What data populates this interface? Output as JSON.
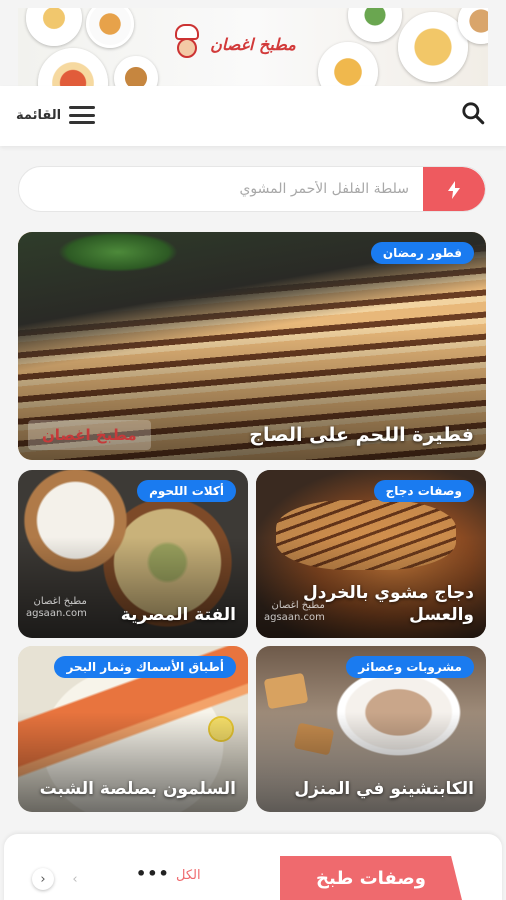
{
  "banner": {
    "logo_text": "مطبخ اغصان"
  },
  "header": {
    "menu_label": "القائمة"
  },
  "search": {
    "placeholder": "سلطة الفلفل الأحمر المشوي"
  },
  "featured": {
    "tag": "فطور رمضان",
    "title": "فطيرة اللحم على الصاج",
    "watermark": "مطبخ اغصان"
  },
  "cards": [
    {
      "tag": "وصفات دجاج",
      "title": "دجاج مشوي بالخردل والعسل",
      "watermark": "مطبخ اغصان\nagsaan.com"
    },
    {
      "tag": "أكلات اللحوم",
      "title": "الفتة المصرية",
      "watermark": "مطبخ اغصان\nagsaan.com"
    },
    {
      "tag": "مشروبات وعصائر",
      "title": "الكابتشينو في المنزل"
    },
    {
      "tag": "أطباق الأسماك وثمار البحر",
      "title": "السلمون بصلصة الشبت"
    }
  ],
  "section": {
    "title": "وصفات طبخ",
    "all_label": "الكل",
    "more": "•••"
  },
  "icons": {
    "search": "search-icon",
    "menu": "hamburger-icon",
    "bolt": "lightning-icon",
    "prev": "chevron-left-icon",
    "next": "chevron-right-icon"
  },
  "colors": {
    "accent": "#ee5a5f",
    "tag_blue": "#1a7bf0"
  }
}
